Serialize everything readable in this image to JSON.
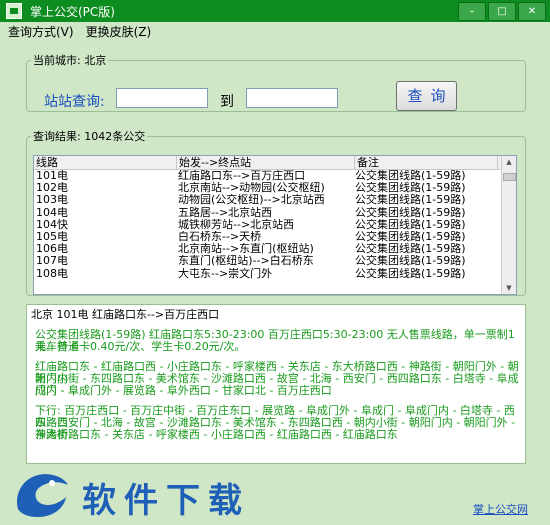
{
  "window": {
    "title": "掌上公交(PC版)"
  },
  "menu": {
    "items": [
      "查询方式(V)",
      "更换皮肤(Z)"
    ]
  },
  "search": {
    "legend": "当前城市: 北京",
    "label": "站站查询:",
    "from_value": "",
    "to_label": "到",
    "to_value": "",
    "button": "查询"
  },
  "results": {
    "legend": "查询结果: 1042条公交",
    "columns": [
      "线路",
      "始发-->终点站",
      "备注"
    ],
    "rows": [
      [
        "101电",
        "红庙路口东-->百万庄西口",
        "公交集团线路(1-59路)"
      ],
      [
        "102电",
        "北京南站-->动物园(公交枢纽)",
        "公交集团线路(1-59路)"
      ],
      [
        "103电",
        "动物园(公交枢纽)-->北京站西",
        "公交集团线路(1-59路)"
      ],
      [
        "104电",
        "五路居-->北京站西",
        "公交集团线路(1-59路)"
      ],
      [
        "104快",
        "城铁柳芳站-->北京站西",
        "公交集团线路(1-59路)"
      ],
      [
        "105电",
        "白石桥东-->天桥",
        "公交集团线路(1-59路)"
      ],
      [
        "106电",
        "北京南站-->东直门(枢纽站)",
        "公交集团线路(1-59路)"
      ],
      [
        "107电",
        "东直门(枢纽站)-->白石桥东",
        "公交集团线路(1-59路)"
      ],
      [
        "108电",
        "大屯东-->崇文门外",
        "公交集团线路(1-59路)"
      ]
    ]
  },
  "detail": {
    "header": "北京 101电      红庙路口东-->百万庄西口",
    "info_line1": "公交集团线路(1-59路)      红庙路口东5:30-23:00  百万庄西口5:30-23:00      无人售票线路，单一票制1元。持卡",
    "info_line2": "乘车普通卡0.40元/次、学生卡0.20元/次。",
    "up_line1": "红庙路口东 - 红庙路口西 - 小庄路口东 - 呼家楼西 - 关东店 - 东大桥路口西 - 神路街 - 朝阳门外 - 朝阳门内 -",
    "up_line2": "朝内小街 - 东四路口东 - 美术馆东 - 沙滩路口西 - 故宫 - 北海 - 西安门 - 西四路口东 - 白塔寺 - 阜成门内 - 阜",
    "up_line3": "成门 - 阜成门外 - 展览路 - 阜外西口 - 甘家口北 - 百万庄西口",
    "down_line1": "下行:       百万庄西口 - 百万庄中街 - 百万庄东口 - 展览路 - 阜成门外 - 阜成门 - 阜成门内 - 白塔寺 - 西四路口",
    "down_line2": "东 - 西安门 - 北海 - 故宫 - 沙滩路口东 - 美术馆东 - 东四路口西 - 朝内小街 - 朝阳门内 - 朝阳门外 - 神路街 -",
    "down_line3": "东大桥路口东 - 关东店 - 呼家楼西 - 小庄路口西 - 红庙路口西 - 红庙路口东"
  },
  "footer": {
    "link": "掌上公交网"
  },
  "watermark": {
    "text": "软件下载"
  },
  "colors": {
    "titlebar": "#0d8c1f",
    "background": "#cfe6c7",
    "detail_text": "#189a1c",
    "accent_blue": "#1a4fbf"
  }
}
